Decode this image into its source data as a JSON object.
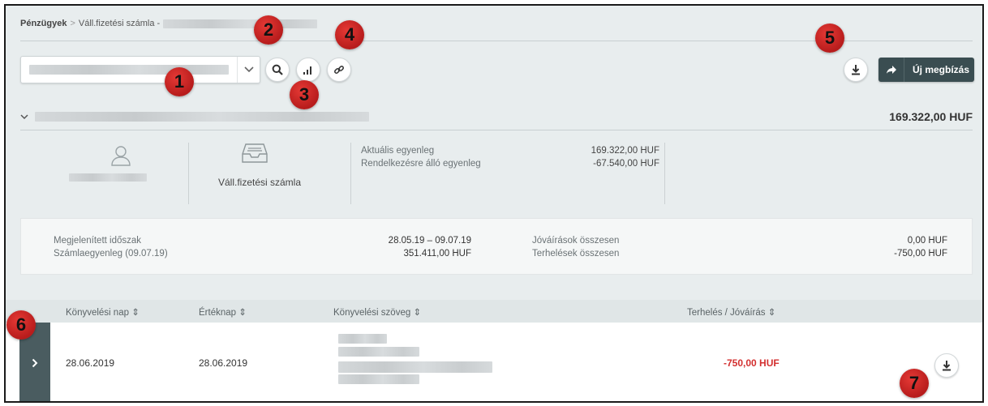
{
  "breadcrumb": {
    "root": "Pénzügyek",
    "separator": ">",
    "current": "Váll.fizetési számla -"
  },
  "toolbar": {
    "new_order_label": "Új megbízás"
  },
  "account": {
    "total": "169.322,00 HUF",
    "type": "Váll.fizetési számla",
    "balance_labels": [
      "Aktuális egyenleg",
      "Rendelkezésre álló egyenleg"
    ],
    "balance_values": [
      "169.322,00 HUF",
      "-67.540,00 HUF"
    ]
  },
  "period": {
    "label_period": "Megjelenített időszak",
    "label_balance": "Számlaegyenleg (09.07.19)",
    "value_period": "28.05.19 – 09.07.19",
    "value_balance": "351.411,00 HUF",
    "label_credits": "Jóváírások összesen",
    "label_debits": "Terhelések összesen",
    "value_credits": "0,00 HUF",
    "value_debits": "-750,00 HUF"
  },
  "table": {
    "headers": [
      "Könyvelési nap ⇕",
      "Értéknap ⇕",
      "Könyvelési szöveg ⇕",
      "Terhelés / Jóváírás ⇕"
    ],
    "rows": [
      {
        "booking_date": "28.06.2019",
        "value_date": "28.06.2019",
        "amount": "-750,00 HUF"
      }
    ]
  },
  "markers": [
    "1",
    "2",
    "3",
    "4",
    "5",
    "6",
    "7"
  ],
  "colors": {
    "accent_dark": "#3a4d51",
    "negative": "#d32f2f",
    "marker": "#c62828"
  }
}
